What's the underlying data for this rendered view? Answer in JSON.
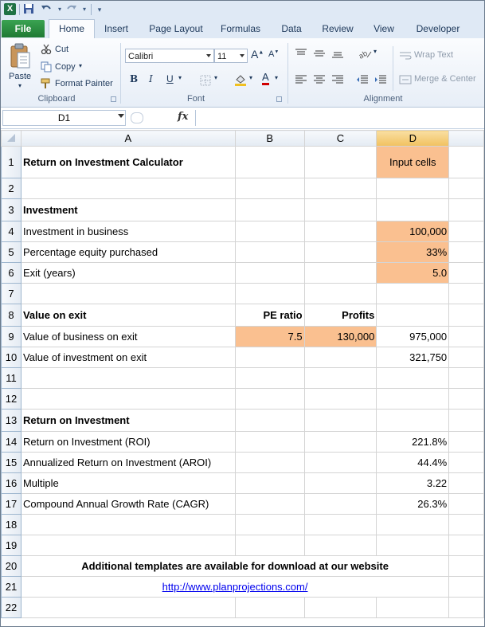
{
  "app": {
    "qat_icons": [
      "excel-logo-icon",
      "save-icon",
      "undo-icon",
      "redo-icon",
      "customize-icon"
    ]
  },
  "tabs": [
    "File",
    "Home",
    "Insert",
    "Page Layout",
    "Formulas",
    "Data",
    "Review",
    "View",
    "Developer"
  ],
  "ribbon": {
    "clipboard": {
      "paste": "Paste",
      "cut": "Cut",
      "copy": "Copy",
      "format_painter": "Format Painter",
      "label": "Clipboard"
    },
    "font": {
      "name": "Calibri",
      "size": "11",
      "bold": "B",
      "italic": "I",
      "underline": "U",
      "label": "Font"
    },
    "alignment": {
      "wrap_text": "Wrap Text",
      "merge_center": "Merge & Center",
      "label": "Alignment"
    }
  },
  "formula_bar": {
    "name_box": "D1",
    "fx": "fx",
    "value": ""
  },
  "sheet": {
    "columns": [
      "A",
      "B",
      "C",
      "D"
    ],
    "selected_column": "D",
    "rows": [
      {
        "n": "1",
        "a": "Return on Investment Calculator",
        "b": "",
        "c": "",
        "d": "Input cells"
      },
      {
        "n": "2",
        "a": "",
        "b": "",
        "c": "",
        "d": ""
      },
      {
        "n": "3",
        "a": "Investment",
        "b": "",
        "c": "",
        "d": ""
      },
      {
        "n": "4",
        "a": "Investment in business",
        "b": "",
        "c": "",
        "d": "100,000"
      },
      {
        "n": "5",
        "a": "Percentage equity purchased",
        "b": "",
        "c": "",
        "d": "33%"
      },
      {
        "n": "6",
        "a": "Exit (years)",
        "b": "",
        "c": "",
        "d": "5.0"
      },
      {
        "n": "7",
        "a": "",
        "b": "",
        "c": "",
        "d": ""
      },
      {
        "n": "8",
        "a": "Value on exit",
        "b": "PE ratio",
        "c": "Profits",
        "d": ""
      },
      {
        "n": "9",
        "a": "Value of business on exit",
        "b": "7.5",
        "c": "130,000",
        "d": "975,000"
      },
      {
        "n": "10",
        "a": "Value of investment on exit",
        "b": "",
        "c": "",
        "d": "321,750"
      },
      {
        "n": "11",
        "a": "",
        "b": "",
        "c": "",
        "d": ""
      },
      {
        "n": "12",
        "a": "",
        "b": "",
        "c": "",
        "d": ""
      },
      {
        "n": "13",
        "a": "Return on Investment",
        "b": "",
        "c": "",
        "d": ""
      },
      {
        "n": "14",
        "a": "Return on Investment (ROI)",
        "b": "",
        "c": "",
        "d": "221.8%"
      },
      {
        "n": "15",
        "a": "Annualized Return on Investment (AROI)",
        "b": "",
        "c": "",
        "d": "44.4%"
      },
      {
        "n": "16",
        "a": "Multiple",
        "b": "",
        "c": "",
        "d": "3.22"
      },
      {
        "n": "17",
        "a": "Compound Annual Growth Rate (CAGR)",
        "b": "",
        "c": "",
        "d": "26.3%"
      },
      {
        "n": "18",
        "a": "",
        "b": "",
        "c": "",
        "d": ""
      },
      {
        "n": "19",
        "a": "",
        "b": "",
        "c": "",
        "d": ""
      },
      {
        "n": "20",
        "a": "Additional templates are available for download at our website",
        "b": "",
        "c": "",
        "d": ""
      },
      {
        "n": "21",
        "a": "http://www.planprojections.com/",
        "b": "",
        "c": "",
        "d": ""
      },
      {
        "n": "22",
        "a": "",
        "b": "",
        "c": "",
        "d": ""
      }
    ]
  },
  "colors": {
    "input_fill": "#fac090",
    "file_tab": "#2a8a3e",
    "selected_header": "#f1c15f",
    "link": "#0000ee"
  }
}
